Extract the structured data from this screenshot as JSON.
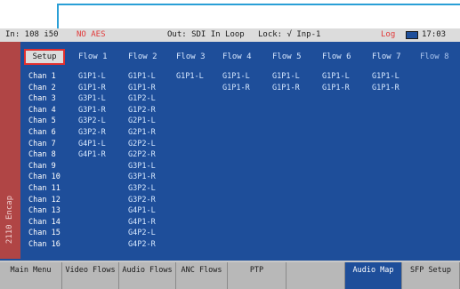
{
  "status": {
    "input": "In: 108 i50",
    "alarm": "NO AES",
    "output": "Out: SDI In Loop",
    "lock": "Lock: √ Inp-1",
    "log": "Log",
    "time": "17:03"
  },
  "side_tab": "2110 Encap",
  "setup_label": "Setup",
  "flows": [
    "Flow 1",
    "Flow 2",
    "Flow 3",
    "Flow 4",
    "Flow 5",
    "Flow 6",
    "Flow 7",
    "Flow 8"
  ],
  "channels": [
    "Chan 1",
    "Chan 2",
    "Chan 3",
    "Chan 4",
    "Chan 5",
    "Chan 6",
    "Chan 7",
    "Chan 8",
    "Chan 9",
    "Chan 10",
    "Chan 11",
    "Chan 12",
    "Chan 13",
    "Chan 14",
    "Chan 15",
    "Chan 16"
  ],
  "grid": [
    [
      "G1P1-L",
      "G1P1-L",
      "G1P1-L",
      "G1P1-L",
      "G1P1-L",
      "G1P1-L",
      "G1P1-L",
      ""
    ],
    [
      "G1P1-R",
      "G1P1-R",
      "",
      "G1P1-R",
      "G1P1-R",
      "G1P1-R",
      "G1P1-R",
      ""
    ],
    [
      "G3P1-L",
      "G1P2-L",
      "",
      "",
      "",
      "",
      "",
      ""
    ],
    [
      "G3P1-R",
      "G1P2-R",
      "",
      "",
      "",
      "",
      "",
      ""
    ],
    [
      "G3P2-L",
      "G2P1-L",
      "",
      "",
      "",
      "",
      "",
      ""
    ],
    [
      "G3P2-R",
      "G2P1-R",
      "",
      "",
      "",
      "",
      "",
      ""
    ],
    [
      "G4P1-L",
      "G2P2-L",
      "",
      "",
      "",
      "",
      "",
      ""
    ],
    [
      "G4P1-R",
      "G2P2-R",
      "",
      "",
      "",
      "",
      "",
      ""
    ],
    [
      "",
      "G3P1-L",
      "",
      "",
      "",
      "",
      "",
      ""
    ],
    [
      "",
      "G3P1-R",
      "",
      "",
      "",
      "",
      "",
      ""
    ],
    [
      "",
      "G3P2-L",
      "",
      "",
      "",
      "",
      "",
      ""
    ],
    [
      "",
      "G3P2-R",
      "",
      "",
      "",
      "",
      "",
      ""
    ],
    [
      "",
      "G4P1-L",
      "",
      "",
      "",
      "",
      "",
      ""
    ],
    [
      "",
      "G4P1-R",
      "",
      "",
      "",
      "",
      "",
      ""
    ],
    [
      "",
      "G4P2-L",
      "",
      "",
      "",
      "",
      "",
      ""
    ],
    [
      "",
      "G4P2-R",
      "",
      "",
      "",
      "",
      "",
      ""
    ]
  ],
  "softkeys": [
    {
      "label": "Main Menu",
      "active": false
    },
    {
      "label": "Video Flows",
      "active": false
    },
    {
      "label": "Audio Flows",
      "active": false
    },
    {
      "label": "ANC Flows",
      "active": false
    },
    {
      "label": "PTP",
      "active": false
    },
    {
      "label": "",
      "active": false
    },
    {
      "label": "Audio Map",
      "active": true
    },
    {
      "label": "SFP Setup",
      "active": false
    }
  ],
  "colors": {
    "screen_bg": "#1e4e9a",
    "side_tab": "#b04545",
    "alarm": "#e23a3a",
    "highlight": "#e03030",
    "callout": "#2a9fd6"
  },
  "icons": {
    "battery": "battery-icon"
  }
}
